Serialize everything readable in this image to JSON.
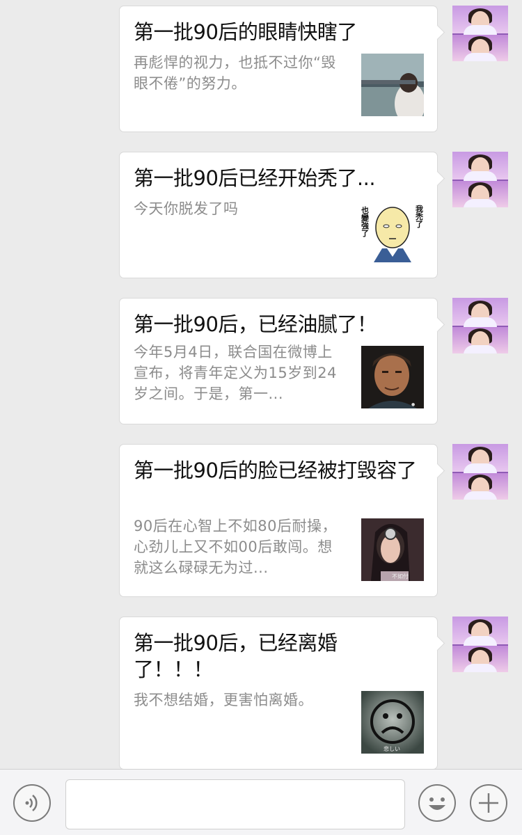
{
  "messages": [
    {
      "title": "第一批90后的眼睛快瞎了",
      "desc": "再彪悍的视力，也抵不过你“毁眼不倦”的努力。",
      "thumbnail": "woman-blindfold-photo"
    },
    {
      "title": "第一批90后已经开始秃了...",
      "desc": "今天你脱发了吗",
      "thumbnail": "bald-cartoon-meme",
      "thumb_text_left": "也變強了",
      "thumb_text_right": "我禿了"
    },
    {
      "title": "第一批90后，已经油腻了！",
      "desc": "今年5月4日，联合国在微博上宣布，将青年定义为15岁到24岁之间。于是，第一...",
      "thumbnail": "middle-aged-man-photo"
    },
    {
      "title": "第一批90后的脸已经被打毁容了",
      "desc": "90后在心智上不如80后耐操，心劲儿上又不如00后敢闯。想就这么碌碌无为过...",
      "thumbnail": "girl-headphones-photo",
      "thumb_caption": "不如付"
    },
    {
      "title": "第一批90后，已经离婚了！！！",
      "desc": "我不想结婚，更害怕离婚。",
      "thumbnail": "sad-face-photo",
      "thumb_caption": "悲しい"
    }
  ],
  "input_bar": {
    "voice_icon": "voice-icon",
    "emoji_icon": "emoji-icon",
    "plus_icon": "plus-icon",
    "text_value": ""
  },
  "colors": {
    "background": "#ebebeb",
    "card": "#ffffff",
    "title_text": "#111111",
    "desc_text": "#8c8c8c",
    "avatar": "#c89ae3"
  }
}
